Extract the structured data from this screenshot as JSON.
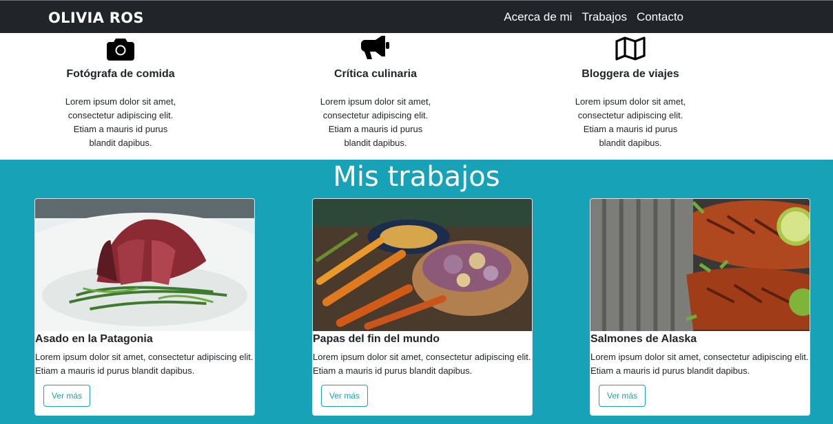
{
  "navbar": {
    "brand": "OLIVIA ROS",
    "links": [
      "Acerca de mi",
      "Trabajos",
      "Contacto"
    ]
  },
  "services": [
    {
      "icon": "camera-icon",
      "title": "Fotógrafa de comida",
      "text": "Lorem ipsum dolor sit amet, consectetur adipiscing elit. Etiam a mauris id purus blandit dapibus."
    },
    {
      "icon": "megaphone-icon",
      "title": "Crítica culinaria",
      "text": "Lorem ipsum dolor sit amet, consectetur adipiscing elit. Etiam a mauris id purus blandit dapibus."
    },
    {
      "icon": "map-icon",
      "title": "Bloggera de viajes",
      "text": "Lorem ipsum dolor sit amet, consectetur adipiscing elit. Etiam a mauris id purus blandit dapibus."
    }
  ],
  "works": {
    "title": "Mis trabajos",
    "cards": [
      {
        "title": "Asado en la Patagonia",
        "text": "Lorem ipsum dolor sit amet, consectetur adipiscing elit. Etiam a mauris id purus blandit dapibus.",
        "button": "Ver más"
      },
      {
        "title": "Papas del fin del mundo",
        "text": "Lorem ipsum dolor sit amet, consectetur adipiscing elit. Etiam a mauris id purus blandit dapibus.",
        "button": "Ver más"
      },
      {
        "title": "Salmones de Alaska",
        "text": "Lorem ipsum dolor sit amet, consectetur adipiscing elit. Etiam a mauris id purus blandit dapibus.",
        "button": "Ver más"
      }
    ]
  },
  "colors": {
    "navbar": "#212529",
    "accent": "#17a2b8"
  }
}
